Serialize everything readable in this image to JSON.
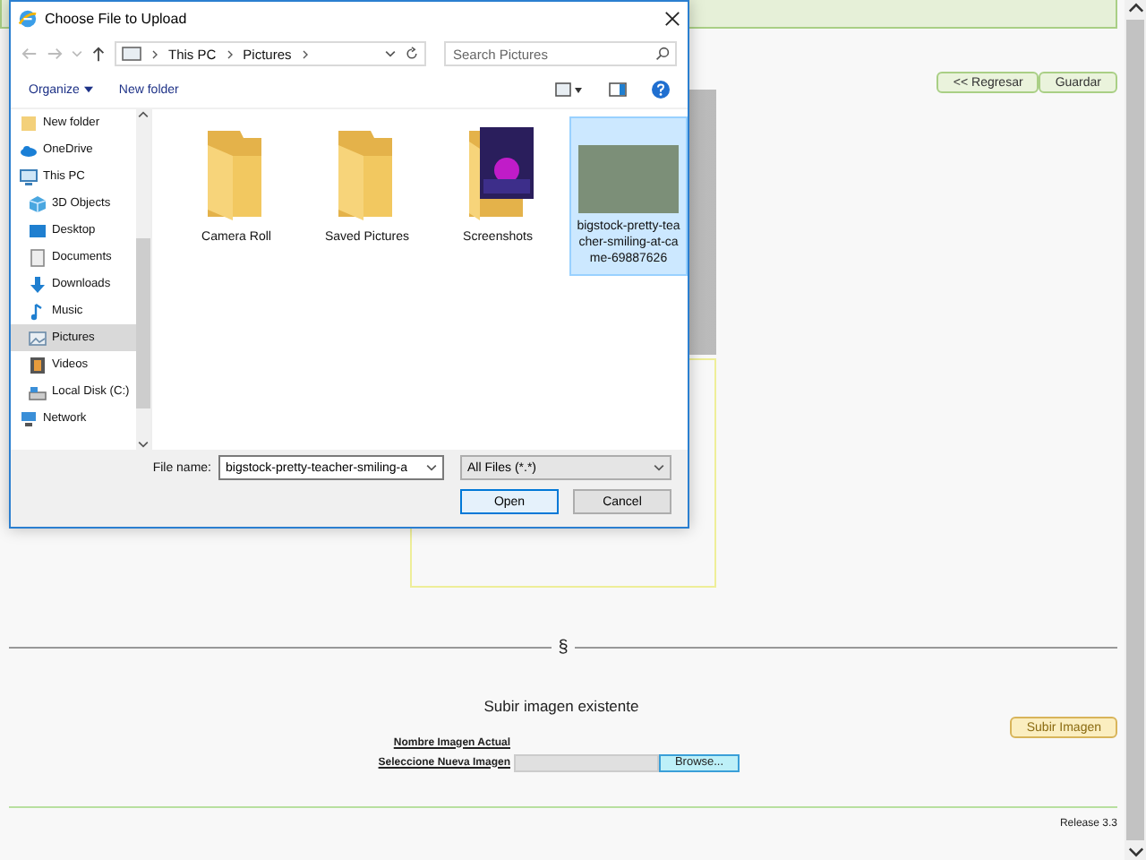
{
  "page": {
    "nav_buttons": [
      "<< Regresar",
      "Guardar"
    ],
    "section_mark": "§",
    "upload": {
      "heading": "Subir imagen existente",
      "button": "Subir Imagen",
      "fields": [
        {
          "label": "Nombre Imagen Actual",
          "kind": "text"
        },
        {
          "label": "Seleccione Nueva Imagen",
          "kind": "file",
          "button": "Browse..."
        }
      ]
    },
    "footer": "Release 3.3"
  },
  "dialog": {
    "title": "Choose File to Upload",
    "breadcrumb": [
      "This PC",
      "Pictures"
    ],
    "search": {
      "placeholder": "Search Pictures"
    },
    "toolbar": [
      "Organize",
      "New folder"
    ],
    "sidebar": [
      {
        "label": "New folder",
        "kind": "folder",
        "selected": false
      },
      {
        "label": "OneDrive",
        "kind": "cloud",
        "selected": false
      },
      {
        "label": "This PC",
        "kind": "computer",
        "selected": false,
        "children": [
          {
            "label": "3D Objects",
            "kind": "cube",
            "selected": false
          },
          {
            "label": "Desktop",
            "kind": "desktop",
            "selected": false
          },
          {
            "label": "Documents",
            "kind": "document",
            "selected": false
          },
          {
            "label": "Downloads",
            "kind": "download",
            "selected": false
          },
          {
            "label": "Music",
            "kind": "music",
            "selected": false
          },
          {
            "label": "Pictures",
            "kind": "pictures",
            "selected": true
          },
          {
            "label": "Videos",
            "kind": "video",
            "selected": false
          },
          {
            "label": "Local Disk (C:)",
            "kind": "disk",
            "selected": false
          }
        ]
      },
      {
        "label": "Network",
        "kind": "network",
        "selected": false
      }
    ],
    "files": [
      {
        "name": "Camera Roll",
        "kind": "folder",
        "selected": false
      },
      {
        "name": "Saved Pictures",
        "kind": "folder",
        "selected": false
      },
      {
        "name": "Screenshots",
        "kind": "folder-preview",
        "selected": false
      },
      {
        "name": "bigstock-pretty-teacher-smiling-at-came-69887626",
        "kind": "photo",
        "selected": true
      }
    ],
    "file_name_label": "File name:",
    "file_name": "bigstock-pretty-teacher-smiling-a",
    "file_type": "All Files (*.*)",
    "buttons": [
      "Open",
      "Cancel"
    ]
  }
}
